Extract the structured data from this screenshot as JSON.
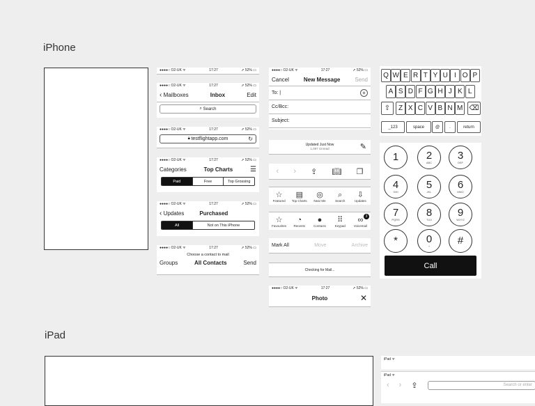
{
  "sections": {
    "iphone": "iPhone",
    "ipad": "iPad"
  },
  "status": {
    "carrier": "O2-UK",
    "time": "17:27",
    "battery": "52%"
  },
  "mail_inbox": {
    "back": "Mailboxes",
    "title": "Inbox",
    "action": "Edit",
    "search": "Search"
  },
  "safari_url": "testflightapp.com",
  "appstore": {
    "left": "Categories",
    "title": "Top Charts",
    "segments": [
      "Paid",
      "Free",
      "Top Grossing"
    ]
  },
  "purchased": {
    "back": "Updates",
    "title": "Purchased",
    "segments": [
      "All",
      "Not on This iPhone"
    ]
  },
  "contacts": {
    "prompt": "Choose a contact to mail",
    "left": "Groups",
    "title": "All Contacts",
    "right": "Send"
  },
  "compose": {
    "cancel": "Cancel",
    "title": "New Message",
    "send": "Send",
    "to": "To:",
    "cc": "Cc/Bcc:",
    "subject": "Subject:"
  },
  "mail_updated": {
    "line1": "Updated Just Now",
    "line2": "1,097 Unread"
  },
  "appstore_tabs": [
    "Featured",
    "Top Charts",
    "Near Me",
    "Search",
    "Updates"
  ],
  "phone_tabs": [
    "Favourites",
    "Recents",
    "Contacts",
    "Keypad",
    "Voicemail"
  ],
  "voicemail_badge": "3",
  "mail_edit": {
    "left": "Mark All",
    "mid": "Move",
    "right": "Archive"
  },
  "checking": "Checking for Mail...",
  "photo": {
    "title": "Photo",
    "close": "✕"
  },
  "keyboard": {
    "row1": [
      "Q",
      "W",
      "E",
      "R",
      "T",
      "Y",
      "U",
      "I",
      "O",
      "P"
    ],
    "row2": [
      "A",
      "S",
      "D",
      "F",
      "G",
      "H",
      "J",
      "K",
      "L"
    ],
    "row3": [
      "Z",
      "X",
      "C",
      "V",
      "B",
      "N",
      "M"
    ],
    "numbers": "_123",
    "space": "space",
    "at": "@",
    "dot": ".",
    "return": "return"
  },
  "keypad": [
    {
      "n": "1",
      "l": ""
    },
    {
      "n": "2",
      "l": "ABC"
    },
    {
      "n": "3",
      "l": "DEF"
    },
    {
      "n": "4",
      "l": "GHI"
    },
    {
      "n": "5",
      "l": "JKL"
    },
    {
      "n": "6",
      "l": "MNO"
    },
    {
      "n": "7",
      "l": "PQRS"
    },
    {
      "n": "8",
      "l": "TUV"
    },
    {
      "n": "9",
      "l": "WXYZ"
    },
    {
      "n": "*",
      "l": ""
    },
    {
      "n": "0",
      "l": "+"
    },
    {
      "n": "#",
      "l": ""
    }
  ],
  "call": "Call",
  "ipad_status": "iPad",
  "ipad_search_placeholder": "Search or enter"
}
